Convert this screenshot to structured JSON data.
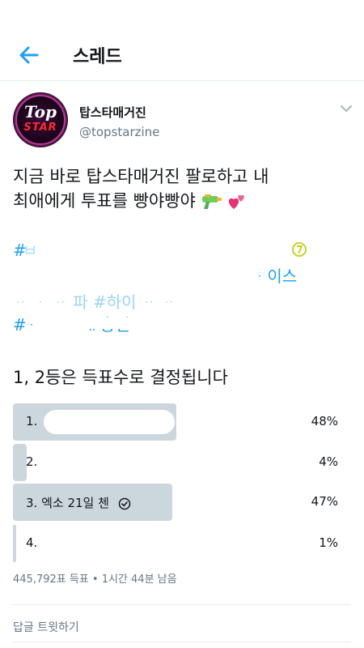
{
  "header": {
    "title": "스레드",
    "back_icon": "arrow-left-icon",
    "accent_color": "#1da1f2"
  },
  "tweet": {
    "display_name": "탑스타매거진",
    "handle": "@topstarzine",
    "avatar": {
      "line1": "Top",
      "line2": "STAR"
    },
    "text_line1": "지금 바로 탑스타매거진 팔로하고 내",
    "text_line2": "최애에게 투표를 빵야빵야",
    "emojis": [
      "water-pistol-emoji",
      "two-hearts-emoji"
    ],
    "hashtag_fragments": [
      "# ",
      "이스",
      "#하이",
      "#총인"
    ]
  },
  "poll": {
    "title": "1, 2등은 득표수로 결정됩니다",
    "options": [
      {
        "label": "1.",
        "percent": "48%",
        "fraction": 0.48,
        "selected": false
      },
      {
        "label": "2.",
        "percent": "4%",
        "fraction": 0.04,
        "selected": false
      },
      {
        "label": "3. 엑소 21일 첸",
        "percent": "47%",
        "fraction": 0.47,
        "selected": true
      },
      {
        "label": "4.",
        "percent": "1%",
        "fraction": 0.01,
        "selected": false
      }
    ],
    "meta": "445,792표 득표 • 1시간 44분 남음",
    "bar_color": "#ccd6dd"
  },
  "reply": {
    "label": "답글 트윗하기"
  }
}
